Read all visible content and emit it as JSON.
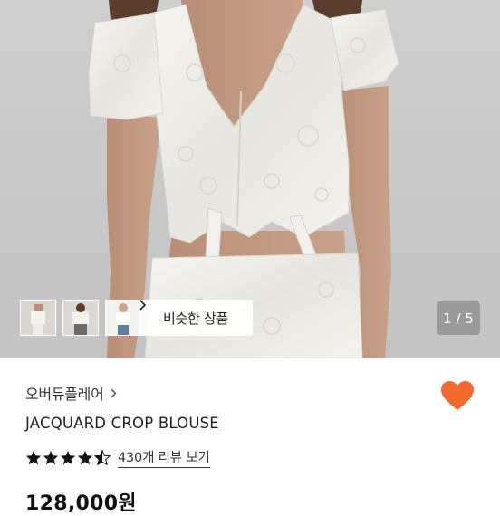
{
  "gallery": {
    "thumbnails": [
      "thumbnail-1",
      "thumbnail-2",
      "thumbnail-3"
    ],
    "similar_button_label": "비슷한 상품",
    "page_indicator": "1 / 5"
  },
  "product": {
    "brand": "오버듀플레어",
    "name": "JACQUARD CROP BLOUSE",
    "rating_value": 4.5,
    "review_link": "430개 리뷰 보기",
    "price": "128,000원"
  },
  "colors": {
    "heart": "#F26A2E",
    "star": "#111111"
  },
  "icons": {
    "brand_chevron": "chevron-right-icon",
    "similar_chevron": "chevron-right-icon",
    "wishlist": "heart-icon",
    "star": "star-icon"
  }
}
